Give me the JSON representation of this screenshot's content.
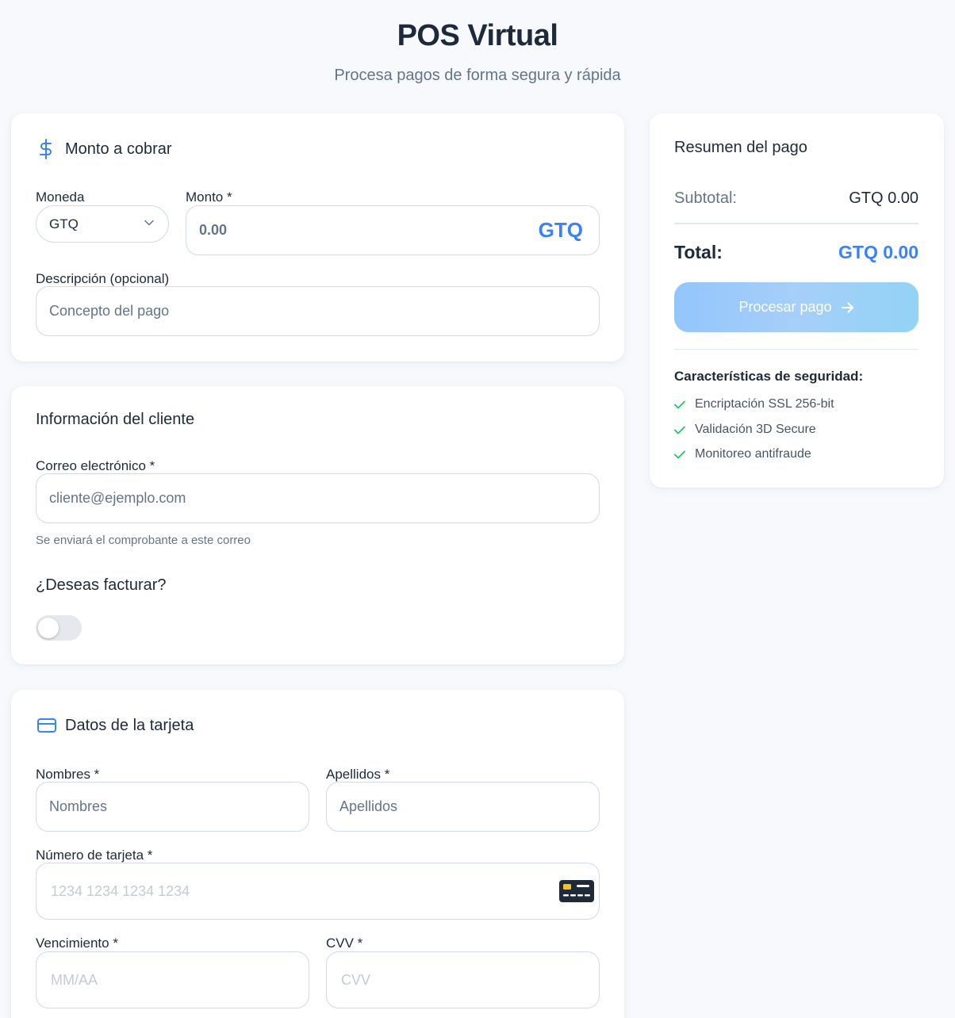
{
  "header": {
    "title": "POS Virtual",
    "subtitle": "Procesa pagos de forma segura y rápida"
  },
  "amount_card": {
    "title": "Monto a cobrar",
    "icon": "dollar-icon",
    "currency_label": "Moneda",
    "currency_value": "GTQ",
    "amount_label": "Monto *",
    "amount_placeholder": "0.00",
    "amount_suffix": "GTQ",
    "description_label": "Descripción (opcional)",
    "description_placeholder": "Concepto del pago"
  },
  "client_card": {
    "title": "Información del cliente",
    "email_label": "Correo electrónico *",
    "email_placeholder": "cliente@ejemplo.com",
    "email_hint": "Se enviará el comprobante a este correo",
    "invoice_question": "¿Deseas facturar?",
    "invoice_enabled": false
  },
  "card_card": {
    "title": "Datos de la tarjeta",
    "icon": "credit-card-icon",
    "first_name_label": "Nombres *",
    "first_name_placeholder": "Nombres",
    "last_name_label": "Apellidos *",
    "last_name_placeholder": "Apellidos",
    "number_label": "Número de tarjeta *",
    "number_placeholder": "1234 1234 1234 1234",
    "expiry_label": "Vencimiento *",
    "expiry_placeholder": "MM/AA",
    "cvv_label": "CVV *",
    "cvv_placeholder": "CVV"
  },
  "summary": {
    "title": "Resumen del pago",
    "subtotal_label": "Subtotal:",
    "subtotal_value": "GTQ 0.00",
    "total_label": "Total:",
    "total_value": "GTQ 0.00",
    "process_button": "Procesar pago",
    "security_title": "Características de seguridad:",
    "security_features": [
      "Encriptación SSL 256-bit",
      "Validación 3D Secure",
      "Monitoreo antifraude"
    ]
  },
  "colors": {
    "accent": "#3b82f6",
    "check": "#22c55e",
    "background": "#f7f9fc"
  }
}
